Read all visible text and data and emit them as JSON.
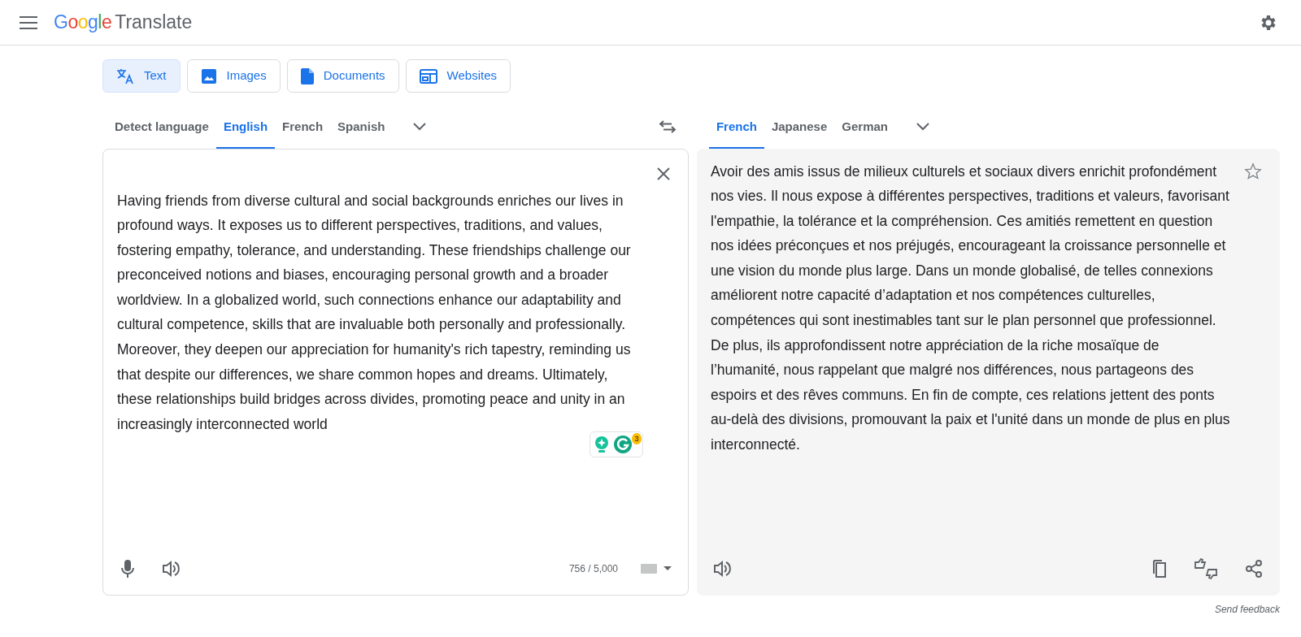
{
  "header": {
    "logo": "Google",
    "product": "Translate"
  },
  "mode_tabs": [
    {
      "label": "Text",
      "kind": "translate",
      "selected": true
    },
    {
      "label": "Images",
      "kind": "image",
      "selected": false
    },
    {
      "label": "Documents",
      "kind": "document",
      "selected": false
    },
    {
      "label": "Websites",
      "kind": "website",
      "selected": false
    }
  ],
  "source_languages": [
    {
      "label": "Detect language",
      "selected": false
    },
    {
      "label": "English",
      "selected": true
    },
    {
      "label": "French",
      "selected": false
    },
    {
      "label": "Spanish",
      "selected": false
    }
  ],
  "target_languages": [
    {
      "label": "French",
      "selected": true
    },
    {
      "label": "Japanese",
      "selected": false
    },
    {
      "label": "German",
      "selected": false
    }
  ],
  "source": {
    "text": "Having friends from diverse cultural and social backgrounds enriches our lives in profound ways. It exposes us to different perspectives, traditions, and values, fostering empathy, tolerance, and understanding. These friendships challenge our preconceived notions and biases, encouraging personal growth and a broader worldview. In a globalized world, such connections enhance our adaptability and cultural competence, skills that are invaluable both personally and professionally. Moreover, they deepen our appreciation for humanity's rich tapestry, reminding us that despite our differences, we share common hopes and dreams. Ultimately, these relationships build bridges across divides, promoting peace and unity in an increasingly interconnected world",
    "char_count": "756 / 5,000",
    "grammarly_badge": "3"
  },
  "translation": {
    "text": "Avoir des amis issus de milieux culturels et sociaux divers enrichit profondément nos vies. Il nous expose à différentes perspectives, traditions et valeurs, favorisant l'empathie, la tolérance et la compréhension. Ces amitiés remettent en question nos idées préconçues et nos préjugés, encourageant la croissance personnelle et une vision du monde plus large. Dans un monde globalisé, de telles connexions améliorent notre capacité d’adaptation et nos compétences culturelles, compétences qui sont inestimables tant sur le plan personnel que professionnel. De plus, ils approfondissent notre appréciation de la riche mosaïque de l’humanité, nous rappelant que malgré nos différences, nous partageons des espoirs et des rêves communs. En fin de compte, ces relations jettent des ponts au-delà des divisions, promouvant la paix et l'unité dans un monde de plus en plus interconnecté.",
    "saved": false
  },
  "feedback_link": "Send feedback"
}
